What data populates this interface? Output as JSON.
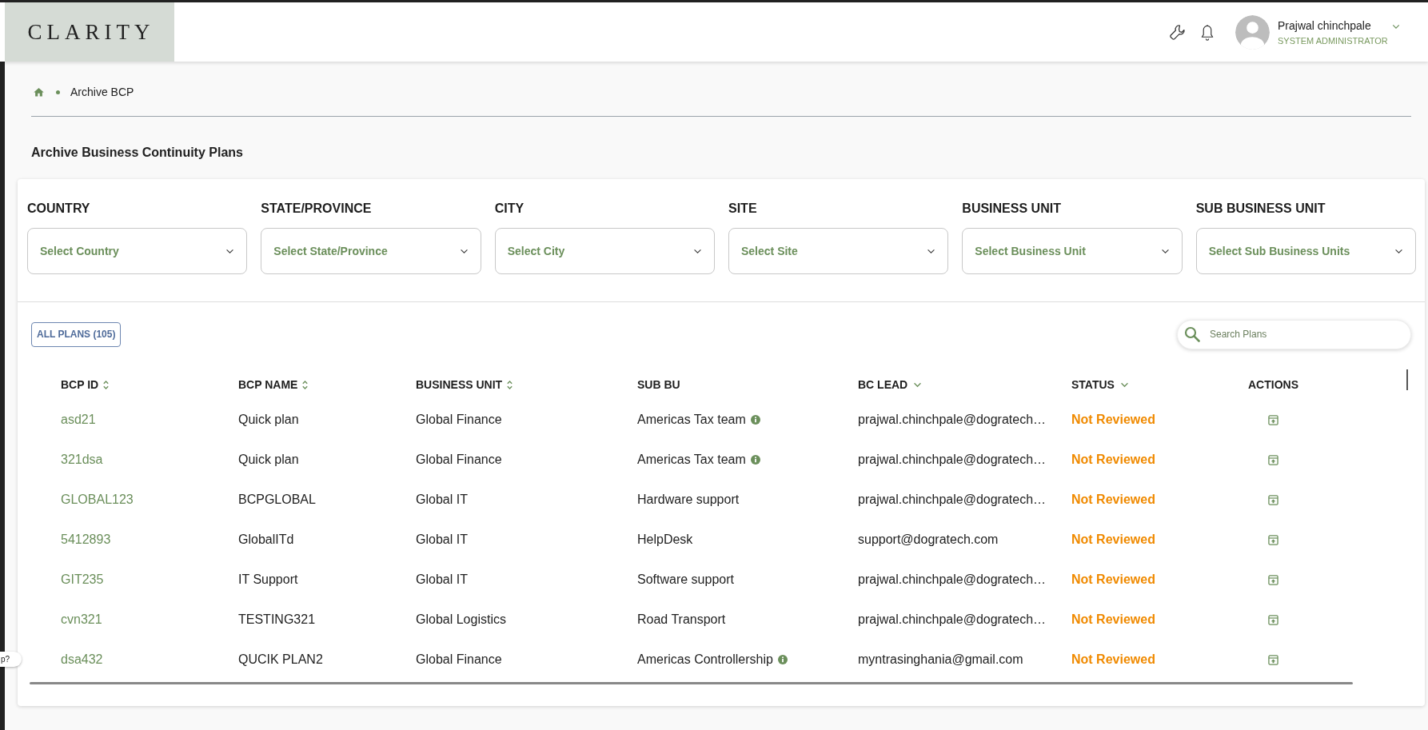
{
  "header": {
    "logo": "CLARITY",
    "user": {
      "name": "Prajwal chinchpale",
      "role": "SYSTEM ADMINISTRATOR"
    }
  },
  "help_tab": {
    "label": "p?"
  },
  "breadcrumb": {
    "current": "Archive BCP"
  },
  "page_title": "Archive Business Continuity Plans",
  "filters": [
    {
      "label": "COUNTRY",
      "placeholder": "Select Country"
    },
    {
      "label": "STATE/PROVINCE",
      "placeholder": "Select State/Province"
    },
    {
      "label": "CITY",
      "placeholder": "Select City"
    },
    {
      "label": "SITE",
      "placeholder": "Select Site"
    },
    {
      "label": "BUSINESS UNIT",
      "placeholder": "Select Business Unit"
    },
    {
      "label": "SUB BUSINESS UNIT",
      "placeholder": "Select Sub Business Units"
    }
  ],
  "all_plans_button": "ALL PLANS (105)",
  "search": {
    "placeholder": "Search Plans"
  },
  "table": {
    "columns": [
      {
        "label": "BCP ID",
        "kind": "sortable"
      },
      {
        "label": "BCP NAME",
        "kind": "sortable"
      },
      {
        "label": "BUSINESS UNIT",
        "kind": "sortable"
      },
      {
        "label": "SUB BU",
        "kind": "plain"
      },
      {
        "label": "BC LEAD",
        "kind": "dropdown"
      },
      {
        "label": "STATUS",
        "kind": "dropdown"
      },
      {
        "label": "ACTIONS",
        "kind": "plain"
      }
    ],
    "rows": [
      {
        "bcp_id": "asd21",
        "bcp_name": "Quick plan",
        "business_unit": "Global Finance",
        "sub_bu": "Americas Tax team",
        "info": true,
        "bc_lead": "prajwal.chinchpale@dogratech…",
        "status": "Not Reviewed"
      },
      {
        "bcp_id": "321dsa",
        "bcp_name": "Quick plan",
        "business_unit": "Global Finance",
        "sub_bu": "Americas Tax team",
        "info": true,
        "bc_lead": "prajwal.chinchpale@dogratech…",
        "status": "Not Reviewed"
      },
      {
        "bcp_id": "GLOBAL123",
        "bcp_name": "BCPGLOBAL",
        "business_unit": "Global IT",
        "sub_bu": "Hardware support",
        "info": false,
        "bc_lead": "prajwal.chinchpale@dogratech…",
        "status": "Not Reviewed"
      },
      {
        "bcp_id": "5412893",
        "bcp_name": "GlobalITd",
        "business_unit": "Global IT",
        "sub_bu": "HelpDesk",
        "info": false,
        "bc_lead": "support@dogratech.com",
        "status": "Not Reviewed"
      },
      {
        "bcp_id": "GIT235",
        "bcp_name": "IT Support",
        "business_unit": "Global IT",
        "sub_bu": "Software support",
        "info": false,
        "bc_lead": "prajwal.chinchpale@dogratech…",
        "status": "Not Reviewed"
      },
      {
        "bcp_id": "cvn321",
        "bcp_name": "TESTING321",
        "business_unit": "Global Logistics",
        "sub_bu": "Road Transport",
        "info": false,
        "bc_lead": "prajwal.chinchpale@dogratech…",
        "status": "Not Reviewed"
      },
      {
        "bcp_id": "dsa432",
        "bcp_name": "QUCIK PLAN2",
        "business_unit": "Global Finance",
        "sub_bu": "Americas Controllership",
        "info": true,
        "bc_lead": "myntrasinghania@gmail.com",
        "status": "Not Reviewed"
      }
    ]
  }
}
